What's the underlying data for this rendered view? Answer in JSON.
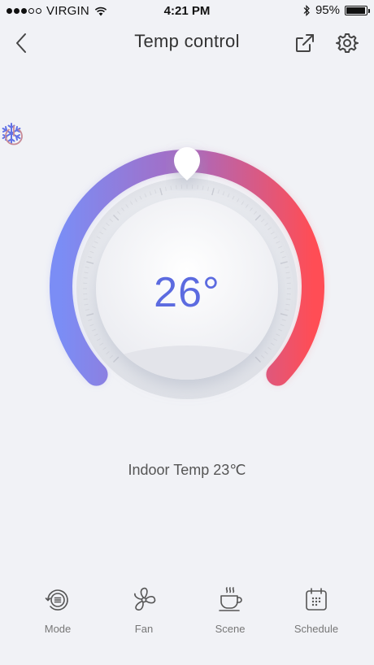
{
  "status": {
    "carrier": "VIRGIN",
    "time": "4:21 PM",
    "battery": "95%",
    "battery_level": 0.95,
    "signal_filled": 3,
    "signal_total": 5
  },
  "nav": {
    "title": "Temp control",
    "back_icon": "chevron-left-icon",
    "share_icon": "share-icon",
    "settings_icon": "gear-icon"
  },
  "thermostat": {
    "set_temp": "26°",
    "mode_icon": "snowflake-icon",
    "power_icon": "power-icon",
    "gradient_start": "#7b8df5",
    "gradient_mid": "#a86ac0",
    "gradient_end": "#ff4d55",
    "temp_color": "#5c6be0"
  },
  "indoor": {
    "label": "Indoor Temp 23℃"
  },
  "tabs": [
    {
      "label": "Mode",
      "icon": "mode-icon"
    },
    {
      "label": "Fan",
      "icon": "fan-icon"
    },
    {
      "label": "Scene",
      "icon": "coffee-cup-icon"
    },
    {
      "label": "Schedule",
      "icon": "calendar-icon"
    }
  ]
}
